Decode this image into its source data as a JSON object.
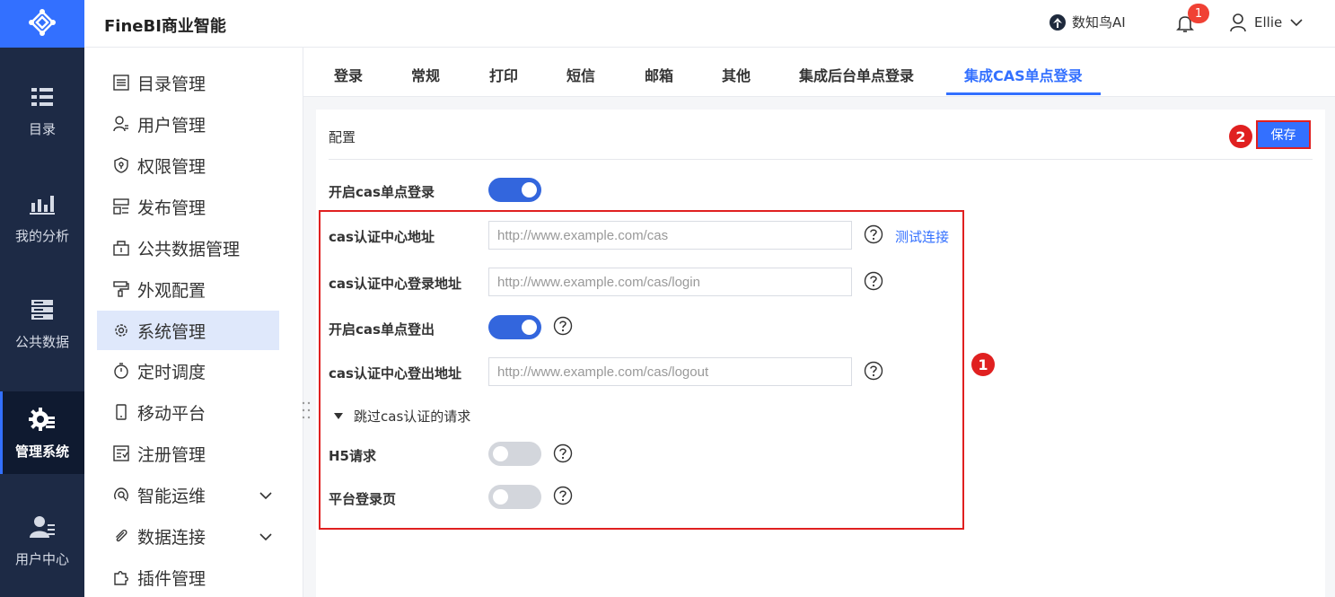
{
  "header": {
    "brand": "FineBI商业智能",
    "ai_label": "数知鸟AI",
    "notification_count": "1",
    "user_name": "Ellie"
  },
  "rail": {
    "items": [
      {
        "label": "目录",
        "icon": "catalog-icon"
      },
      {
        "label": "我的分析",
        "icon": "analysis-icon"
      },
      {
        "label": "公共数据",
        "icon": "public-data-icon"
      },
      {
        "label": "管理系统",
        "icon": "admin-gear-icon"
      },
      {
        "label": "用户中心",
        "icon": "user-center-icon"
      }
    ],
    "active": "管理系统"
  },
  "menu": {
    "items": [
      {
        "label": "目录管理",
        "icon": "list-icon"
      },
      {
        "label": "用户管理",
        "icon": "user-icon"
      },
      {
        "label": "权限管理",
        "icon": "shield-icon"
      },
      {
        "label": "发布管理",
        "icon": "publish-icon"
      },
      {
        "label": "公共数据管理",
        "icon": "database-icon"
      },
      {
        "label": "外观配置",
        "icon": "paint-roller-icon"
      },
      {
        "label": "系统管理",
        "icon": "gear-icon"
      },
      {
        "label": "定时调度",
        "icon": "stopwatch-icon"
      },
      {
        "label": "移动平台",
        "icon": "mobile-icon"
      },
      {
        "label": "注册管理",
        "icon": "register-icon"
      },
      {
        "label": "智能运维",
        "icon": "ops-icon"
      },
      {
        "label": "数据连接",
        "icon": "paperclip-icon"
      },
      {
        "label": "插件管理",
        "icon": "puzzle-icon"
      }
    ],
    "active": "系统管理"
  },
  "tabs": [
    "登录",
    "常规",
    "打印",
    "短信",
    "邮箱",
    "其他",
    "集成后台单点登录",
    "集成CAS单点登录"
  ],
  "active_tab": "集成CAS单点登录",
  "panel": {
    "title": "配置",
    "save_label": "保存",
    "marker_1": "1",
    "marker_2": "2",
    "enable_sso_label": "开启cas单点登录",
    "enable_sso_on": true,
    "cas_url_label": "cas认证中心地址",
    "cas_url_placeholder": "http://www.example.com/cas",
    "test_connection": "测试连接",
    "cas_login_label": "cas认证中心登录地址",
    "cas_login_placeholder": "http://www.example.com/cas/login",
    "enable_logout_label": "开启cas单点登出",
    "enable_logout_on": true,
    "cas_logout_label": "cas认证中心登出地址",
    "cas_logout_placeholder": "http://www.example.com/cas/logout",
    "skip_section_label": "跳过cas认证的请求",
    "h5_label": "H5请求",
    "h5_on": false,
    "platform_login_label": "平台登录页",
    "platform_login_on": false
  },
  "colors": {
    "accent": "#3370ff",
    "rail_bg": "#1d2a45",
    "highlight": "#e02020"
  }
}
